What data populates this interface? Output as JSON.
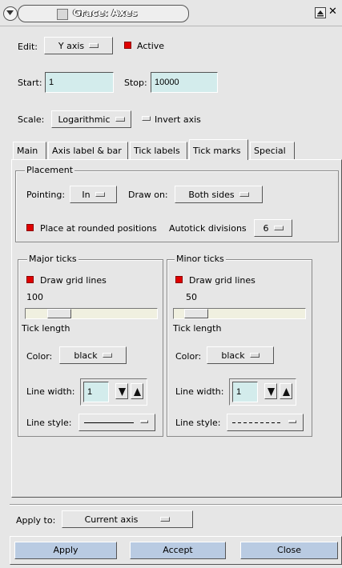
{
  "window": {
    "title": "Grace: Axes"
  },
  "edit": {
    "label": "Edit:",
    "value": "Y axis",
    "active_label": "Active",
    "active_checked": true
  },
  "range": {
    "start_label": "Start:",
    "start_value": "1",
    "stop_label": "Stop:",
    "stop_value": "10000"
  },
  "scale": {
    "label": "Scale:",
    "value": "Logarithmic",
    "invert_label": "Invert axis",
    "invert_checked": false
  },
  "tabs": [
    {
      "label": "Main"
    },
    {
      "label": "Axis label & bar"
    },
    {
      "label": "Tick labels"
    },
    {
      "label": "Tick marks"
    },
    {
      "label": "Special"
    }
  ],
  "active_tab": "Tick marks",
  "placement": {
    "title": "Placement",
    "pointing_label": "Pointing:",
    "pointing_value": "In",
    "draw_on_label": "Draw on:",
    "draw_on_value": "Both sides",
    "rounded_label": "Place at rounded positions",
    "rounded_checked": true,
    "autotick_label": "Autotick divisions",
    "autotick_value": "6"
  },
  "major": {
    "title": "Major ticks",
    "grid_label": "Draw grid lines",
    "grid_checked": true,
    "spacing": "100",
    "tick_length_label": "Tick length",
    "tick_length_level": 0.2,
    "color_label": "Color:",
    "color_value": "black",
    "line_width_label": "Line width:",
    "line_width_value": "1",
    "line_style_label": "Line style:",
    "line_style": "solid"
  },
  "minor": {
    "title": "Minor ticks",
    "grid_label": "Draw grid lines",
    "grid_checked": true,
    "spacing": "50",
    "tick_length_label": "Tick length",
    "tick_length_level": 0.1,
    "color_label": "Color:",
    "color_value": "black",
    "line_width_label": "Line width:",
    "line_width_value": "1",
    "line_style_label": "Line style:",
    "line_style": "dashed"
  },
  "apply_to": {
    "label": "Apply to:",
    "value": "Current axis"
  },
  "buttons": {
    "apply": "Apply",
    "accept": "Accept",
    "close": "Close"
  },
  "colors": {
    "field_bg": "#d3ecec",
    "check_on": "#e00000",
    "button_bg": "#b9cbe2",
    "panel_bg": "#e6e6e6"
  }
}
